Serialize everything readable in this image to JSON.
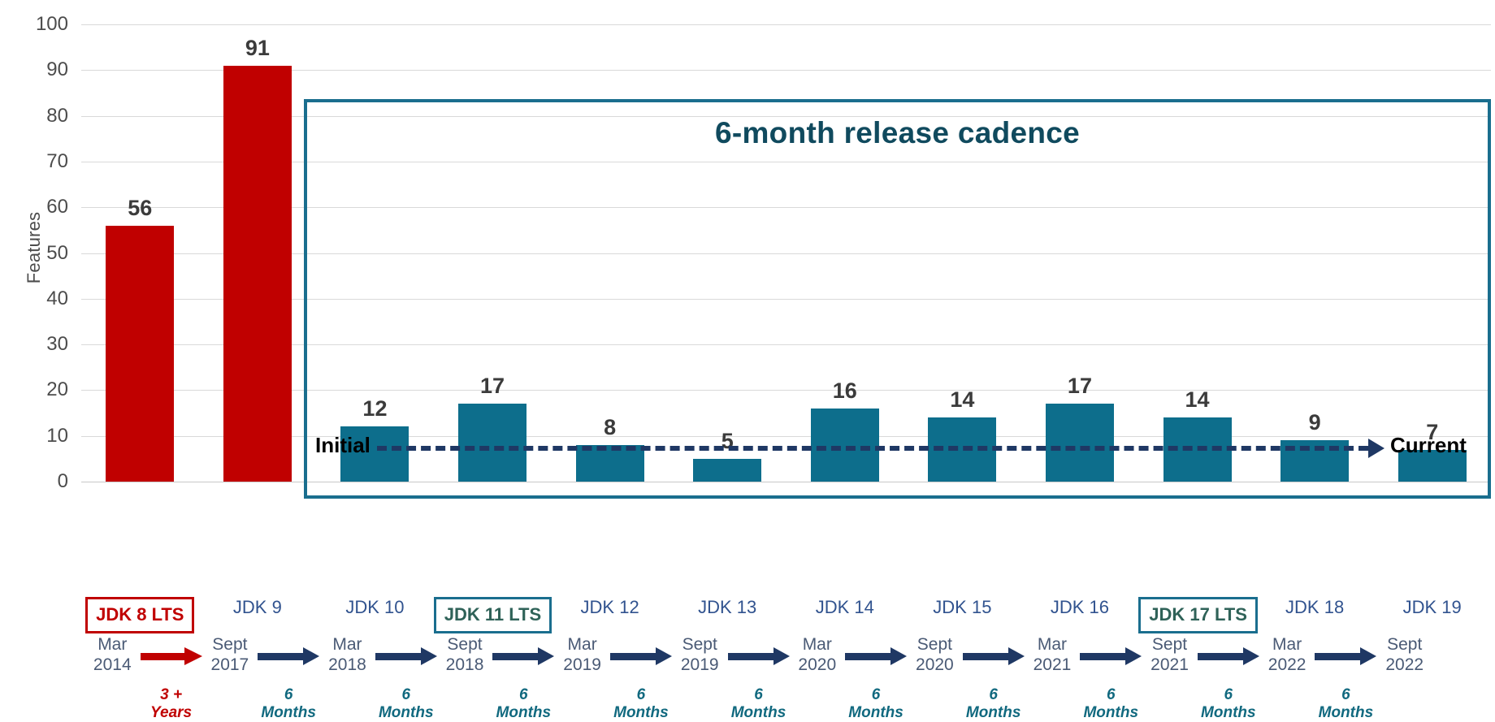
{
  "chart_data": {
    "type": "bar",
    "title": "6-month release cadence",
    "xlabel": "",
    "ylabel": "Features",
    "ylim": [
      0,
      100
    ],
    "yticks": [
      0,
      10,
      20,
      30,
      40,
      50,
      60,
      70,
      80,
      90,
      100
    ],
    "grid": true,
    "legend": "none",
    "categories": [
      "JDK 8 LTS",
      "JDK 9",
      "JDK 10",
      "JDK 11 LTS",
      "JDK 12",
      "JDK 13",
      "JDK 14",
      "JDK 15",
      "JDK 16",
      "JDK 17 LTS",
      "JDK 18",
      "JDK 19"
    ],
    "values": [
      56,
      91,
      12,
      17,
      8,
      5,
      16,
      14,
      17,
      14,
      9,
      7
    ],
    "bar_colors": [
      "#c00000",
      "#c00000",
      "#0d6e8c",
      "#0d6e8c",
      "#0d6e8c",
      "#0d6e8c",
      "#0d6e8c",
      "#0d6e8c",
      "#0d6e8c",
      "#0d6e8c",
      "#0d6e8c",
      "#0d6e8c"
    ],
    "release_dates": [
      "Mar\n2014",
      "Sept\n2017",
      "Mar\n2018",
      "Sept\n2018",
      "Mar\n2019",
      "Sept\n2019",
      "Mar\n2020",
      "Sept\n2020",
      "Mar\n2021",
      "Sept\n2021",
      "Mar\n2022",
      "Sept\n2022"
    ],
    "intervals": [
      "3 +\nYears",
      "6\nMonths",
      "6\nMonths",
      "6\nMonths",
      "6\nMonths",
      "6\nMonths",
      "6\nMonths",
      "6\nMonths",
      "6\nMonths",
      "6\nMonths",
      "6\nMonths"
    ],
    "annotations": [
      "Initial",
      "Current",
      "6-month release cadence"
    ]
  },
  "axis": {
    "y_title": "Features",
    "ticks": [
      "100",
      "90",
      "80",
      "70",
      "60",
      "50",
      "40",
      "30",
      "20",
      "10",
      "0"
    ]
  },
  "cadence": {
    "title": "6-month release cadence",
    "initial_label": "Initial",
    "current_label": "Current"
  },
  "bars": [
    {
      "label": "JDK 8 LTS",
      "value": "56",
      "lts": true,
      "style": "red"
    },
    {
      "label": "JDK 9",
      "value": "91",
      "lts": false,
      "style": "red"
    },
    {
      "label": "JDK 10",
      "value": "12",
      "lts": false,
      "style": "teal"
    },
    {
      "label": "JDK 11 LTS",
      "value": "17",
      "lts": true,
      "style": "teal"
    },
    {
      "label": "JDK 12",
      "value": "8",
      "lts": false,
      "style": "teal"
    },
    {
      "label": "JDK 13",
      "value": "5",
      "lts": false,
      "style": "teal"
    },
    {
      "label": "JDK 14",
      "value": "16",
      "lts": false,
      "style": "teal"
    },
    {
      "label": "JDK 15",
      "value": "14",
      "lts": false,
      "style": "teal"
    },
    {
      "label": "JDK 16",
      "value": "17",
      "lts": false,
      "style": "teal"
    },
    {
      "label": "JDK 17 LTS",
      "value": "14",
      "lts": true,
      "style": "teal"
    },
    {
      "label": "JDK 18",
      "value": "9",
      "lts": false,
      "style": "teal"
    },
    {
      "label": "JDK 19",
      "value": "7",
      "lts": false,
      "style": "teal"
    }
  ],
  "dates": [
    {
      "month": "Mar",
      "year": "2014"
    },
    {
      "month": "Sept",
      "year": "2017"
    },
    {
      "month": "Mar",
      "year": "2018"
    },
    {
      "month": "Sept",
      "year": "2018"
    },
    {
      "month": "Mar",
      "year": "2019"
    },
    {
      "month": "Sept",
      "year": "2019"
    },
    {
      "month": "Mar",
      "year": "2020"
    },
    {
      "month": "Sept",
      "year": "2020"
    },
    {
      "month": "Mar",
      "year": "2021"
    },
    {
      "month": "Sept",
      "year": "2021"
    },
    {
      "month": "Mar",
      "year": "2022"
    },
    {
      "month": "Sept",
      "year": "2022"
    }
  ],
  "intervals": [
    {
      "num": "3 +",
      "unit": "Years",
      "style": "red"
    },
    {
      "num": "6",
      "unit": "Months",
      "style": "teal"
    },
    {
      "num": "6",
      "unit": "Months",
      "style": "teal"
    },
    {
      "num": "6",
      "unit": "Months",
      "style": "teal"
    },
    {
      "num": "6",
      "unit": "Months",
      "style": "teal"
    },
    {
      "num": "6",
      "unit": "Months",
      "style": "teal"
    },
    {
      "num": "6",
      "unit": "Months",
      "style": "teal"
    },
    {
      "num": "6",
      "unit": "Months",
      "style": "teal"
    },
    {
      "num": "6",
      "unit": "Months",
      "style": "teal"
    },
    {
      "num": "6",
      "unit": "Months",
      "style": "teal"
    },
    {
      "num": "6",
      "unit": "Months",
      "style": "teal"
    }
  ],
  "colors": {
    "red": "#c00000",
    "teal_bar": "#0d6e8c",
    "frame": "#1a6e8e",
    "title": "#104a5e",
    "navy": "#1f3864",
    "category_text": "#31538f",
    "lts_teal_text": "#2f6258",
    "date_text": "#4a5a75",
    "value_text": "#3b3b3b",
    "axis_text": "#4c4c4c",
    "gridline": "#d9d9d9"
  }
}
